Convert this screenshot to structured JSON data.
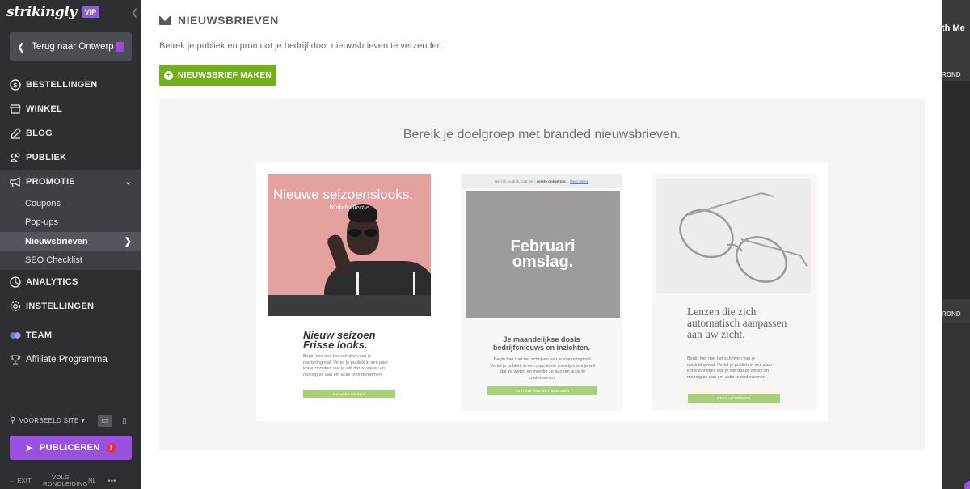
{
  "brand": {
    "logo_text": "strikingly",
    "badge": "VIP"
  },
  "sidebar": {
    "back_label": "Terug naar Ontwerp",
    "items": [
      {
        "label": "BESTELLINGEN",
        "icon": "dollar-circle-icon"
      },
      {
        "label": "WINKEL",
        "icon": "store-icon"
      },
      {
        "label": "BLOG",
        "icon": "pen-icon"
      },
      {
        "label": "PUBLIEK",
        "icon": "users-icon"
      },
      {
        "label": "PROMOTIE",
        "icon": "megaphone-icon"
      }
    ],
    "promotion_sub": [
      {
        "label": "Coupons"
      },
      {
        "label": "Pop-ups"
      },
      {
        "label": "Nieuwsbrieven"
      },
      {
        "label": "SEO Checklist"
      }
    ],
    "items_after": [
      {
        "label": "ANALYTICS",
        "icon": "chart-icon"
      },
      {
        "label": "INSTELLINGEN",
        "icon": "gear-icon"
      },
      {
        "label": "TEAM",
        "icon": "team-icon"
      },
      {
        "label": "Affiliate Programma",
        "icon": "trophy-icon"
      }
    ],
    "preview_label": "VOORBEELD SITE",
    "publish_label": "PUBLICEREN",
    "footer": {
      "exit": "EXIT",
      "tour": "VOLG RONDLEIDING",
      "lang": "NL",
      "more": "•••"
    }
  },
  "main": {
    "title": "NIEUWSBRIEVEN",
    "subtitle": "Betrek je publiek en promoot je bedrijf door nieuwsbrieven te verzenden.",
    "make_button": "NIEUWSBRIEF MAKEN",
    "gallery_heading": "Bereik je doelgroep met branded nieuwsbrieven.",
    "templates": [
      {
        "image_title": "Nieuwe seizoenslooks.",
        "image_subtitle": "Winkelcollectie",
        "title": "Nieuw seizoen Frisse looks.",
        "body": "Begin hier met het schrijven van je marketingmail. Vertel je publiek in een paar korte zinnetjes wat je wilt dat ze weten en moedig ze aan om actie te ondernemen.",
        "button": "GA NAAR DE SITE"
      },
      {
        "top_bar": "We zijn nu druk naar een",
        "top_bar_bold": "eerste ontwerper.",
        "top_bar_link": "Meer weten",
        "image_title": "Februari omslag.",
        "title": "Je maandelijkse dosis bedrijfsnieuws en inzichten.",
        "body": "Begin hier met het schrijven van je marketingmail. Vertel je publiek in een paar korte zinnetjes wat je wilt dat ze weten en moedig ze aan om actie te ondernemen.",
        "button": "LAATSTE PROJECT BEKIJKEN"
      },
      {
        "title": "Lenzen die zich automatisch aanpassen aan uw zicht.",
        "body": "Begin hier met het schrijven van je marketingmail. Vertel je publiek in een paar korte zinnetjes wat je wilt dat ze weten en moedig ze aan om actie te ondernemen.",
        "button": "MEER INFORMATIE"
      }
    ]
  },
  "right_panel": {
    "label_top": "th Me",
    "label_1": "ROND",
    "label_2": "ROND"
  },
  "colors": {
    "accent_green": "#72b01d",
    "accent_purple": "#9b51e0",
    "sidebar_bg": "#2d2f32",
    "alert_red": "#e0324b"
  }
}
